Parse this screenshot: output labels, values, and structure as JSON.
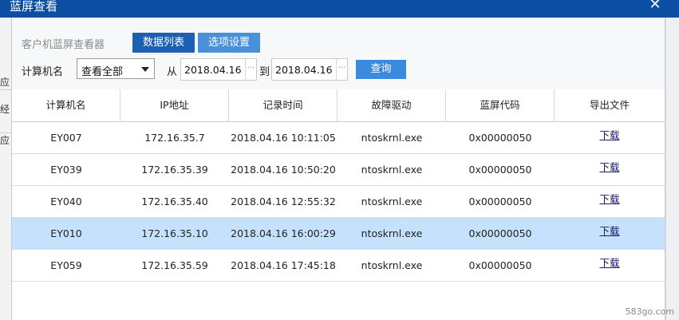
{
  "window": {
    "title": "蓝屏查看",
    "close_glyph": "✕"
  },
  "background_fragments": [
    "应",
    "经",
    "应"
  ],
  "toolbar": {
    "viewer_label": "客户机蓝屏查看器",
    "tabs": [
      {
        "label": "数据列表",
        "active": true
      },
      {
        "label": "选项设置",
        "active": false
      }
    ]
  },
  "filter": {
    "computer_label": "计算机名",
    "computer_select": "查看全部",
    "from_label": "从",
    "from_date": "2018.04.16",
    "to_label": "到",
    "to_date": "2018.04.16",
    "date_picker_glyph": "···",
    "query_button": "查询"
  },
  "table": {
    "headers": [
      "计算机名",
      "IP地址",
      "记录时间",
      "故障驱动",
      "蓝屏代码",
      "导出文件"
    ],
    "rows": [
      {
        "name": "EY007",
        "ip": "172.16.35.7",
        "time": "2018.04.16 10:11:05",
        "driver": "ntoskrnl.exe",
        "code": "0x00000050",
        "export": "下载",
        "selected": false
      },
      {
        "name": "EY039",
        "ip": "172.16.35.39",
        "time": "2018.04.16 10:50:20",
        "driver": "ntoskrnl.exe",
        "code": "0x00000050",
        "export": "下载",
        "selected": false
      },
      {
        "name": "EY040",
        "ip": "172.16.35.40",
        "time": "2018.04.16 12:55:32",
        "driver": "ntoskrnl.exe",
        "code": "0x00000050",
        "export": "下载",
        "selected": false
      },
      {
        "name": "EY010",
        "ip": "172.16.35.10",
        "time": "2018.04.16 16:00:29",
        "driver": "ntoskrnl.exe",
        "code": "0x00000050",
        "export": "下载",
        "selected": true
      },
      {
        "name": "EY059",
        "ip": "172.16.35.59",
        "time": "2018.04.16 17:45:18",
        "driver": "ntoskrnl.exe",
        "code": "0x00000050",
        "export": "下载",
        "selected": false
      }
    ]
  },
  "watermark": {
    "text": "583go.com"
  },
  "colors": {
    "title_bar": "#0d4ea5",
    "active_tab": "#1d5fb2",
    "inactive_tab": "#4a8fd9",
    "query_button": "#3b8ae0",
    "selected_row": "#c5e1fb"
  }
}
